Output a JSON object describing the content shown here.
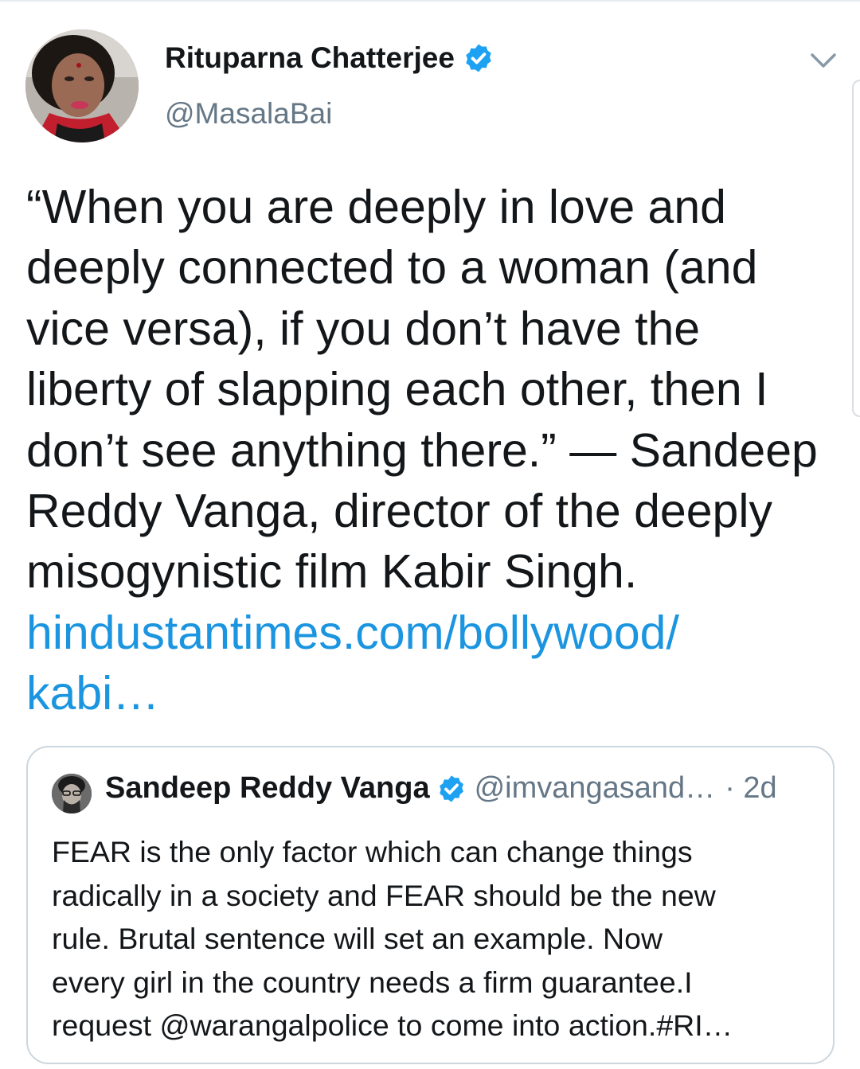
{
  "tweet": {
    "author_name": "Rituparna Chatterjee",
    "author_handle": "@MasalaBai",
    "text_lines": [
      "“When you are deeply in love and",
      "deeply connected to a woman (and",
      "vice versa), if you don’t have the",
      "liberty of slapping each other, then I",
      "don’t see anything there.” — Sandeep",
      "Reddy Vanga, director of the deeply",
      "misogynistic film Kabir Singh."
    ],
    "link_lines": [
      "hindustantimes.com/bollywood/",
      "kabi…"
    ]
  },
  "quoted_tweet": {
    "author_name": "Sandeep Reddy Vanga",
    "author_handle": "@imvangasand…",
    "timestamp": "· 2d",
    "text_lines": [
      "FEAR is the only factor which can change things",
      "radically in a society and FEAR should be the new",
      "rule. Brutal sentence will set an example. Now",
      "every girl in the country needs a firm guarantee.I",
      "request @warangalpolice to come into action.#RI…"
    ]
  },
  "icons": {
    "verified": "verified-badge-icon",
    "more": "chevron-down-icon"
  },
  "colors": {
    "link": "#1b95e0",
    "verified": "#1da1f2",
    "secondary_text": "#657786",
    "card_border": "#ccd6dd"
  }
}
